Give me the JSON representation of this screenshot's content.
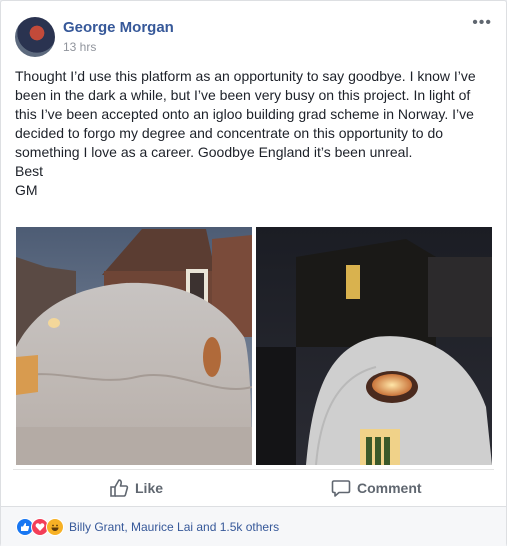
{
  "post": {
    "author": "George Morgan",
    "time": "13 hrs",
    "more_label": "•••",
    "text_lines": [
      "Thought I’d use this platform as an opportunity to say goodbye. I know I’ve been in the dark a while, but I’ve been very busy on this project. In light of this I’ve been accepted onto an igloo building grad scheme in Norway. I’ve decided to forgo my degree and concentrate on this opportunity to do something I love as a career. Goodbye England it’s been unreal.",
      "Best",
      "GM"
    ]
  },
  "actions": {
    "like_label": "Like",
    "comment_label": "Comment"
  },
  "reactions": {
    "summary": "Billy Grant, Maurice Lai and 1.5k others",
    "icons": [
      "like-reaction-icon",
      "love-reaction-icon",
      "haha-reaction-icon"
    ]
  },
  "colors": {
    "author": "#365899",
    "link": "#365899",
    "muted": "#90949c"
  }
}
